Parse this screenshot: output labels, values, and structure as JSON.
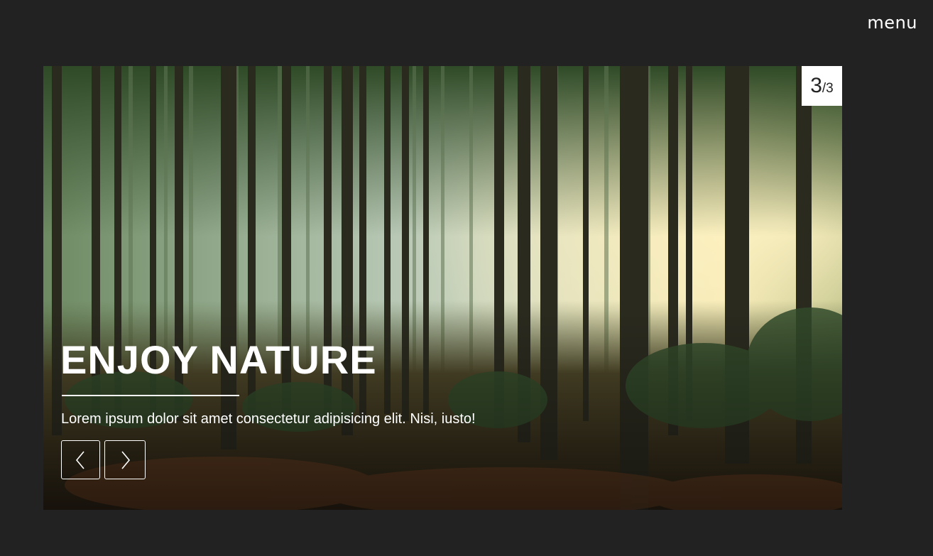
{
  "header": {
    "menu_label": "menu"
  },
  "slider": {
    "current": "3",
    "total": "/3",
    "title": "ENJOY NATURE",
    "description": "Lorem ipsum dolor sit amet consectetur adipisicing elit. Nisi, iusto!",
    "prev_icon": "chevron-left-icon",
    "next_icon": "chevron-right-icon"
  },
  "colors": {
    "background": "#222222",
    "text": "#ffffff",
    "counter_bg": "#ffffff",
    "counter_text": "#222222"
  }
}
